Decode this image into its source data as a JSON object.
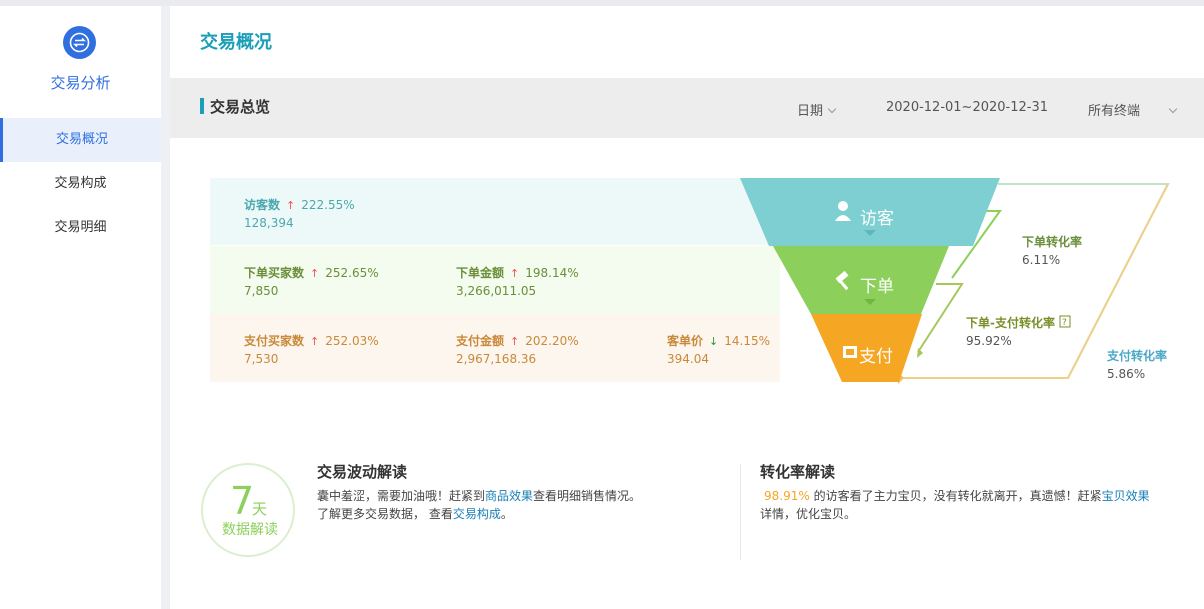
{
  "sidebar": {
    "title": "交易分析",
    "items": [
      {
        "label": "交易概况",
        "active": true
      },
      {
        "label": "交易构成",
        "active": false
      },
      {
        "label": "交易明细",
        "active": false
      }
    ]
  },
  "page": {
    "title": "交易概况",
    "section_title": "交易总览",
    "filters": {
      "date_label": "日期",
      "date_range": "2020-12-01~2020-12-31",
      "terminal": "所有终端"
    }
  },
  "rows": [
    {
      "metrics": [
        {
          "label": "访客数",
          "trend": "up",
          "pct": "222.55%",
          "value": "128,394"
        }
      ]
    },
    {
      "metrics": [
        {
          "label": "下单买家数",
          "trend": "up",
          "pct": "252.65%",
          "value": "7,850"
        },
        {
          "label": "下单金额",
          "trend": "up",
          "pct": "198.14%",
          "value": "3,266,011.05"
        }
      ]
    },
    {
      "metrics": [
        {
          "label": "支付买家数",
          "trend": "up",
          "pct": "252.03%",
          "value": "7,530"
        },
        {
          "label": "支付金额",
          "trend": "up",
          "pct": "202.20%",
          "value": "2,967,168.36"
        },
        {
          "label": "客单价",
          "trend": "down",
          "pct": "14.15%",
          "value": "394.04"
        }
      ]
    }
  ],
  "funnel": {
    "stages": [
      "访客",
      "下单",
      "支付"
    ],
    "rates": [
      {
        "label": "下单转化率",
        "value": "6.11%"
      },
      {
        "label": "下单-支付转化率",
        "value": "95.92%"
      },
      {
        "label": "支付转化率",
        "value": "5.86%"
      }
    ]
  },
  "insights": {
    "badge_number": "7",
    "badge_unit": "天",
    "badge_caption": "数据解读",
    "wave": {
      "title": "交易波动解读",
      "line1_pre": "囊中羞涩，需要加油哦！赶紧到",
      "line1_link": "商品效果",
      "line1_post": "查看明细销售情况。",
      "line2_pre": "了解更多交易数据，  查看",
      "line2_link": "交易构成",
      "line2_post": "。"
    },
    "conversion": {
      "title": "转化率解读",
      "highlight": "98.91%",
      "line1_post": " 的访客看了主力宝贝，没有转化就离开，真遗憾！赶紧",
      "line1_link": "宝贝效果",
      "line2": "详情，优化宝贝。"
    }
  },
  "colors": {
    "accent": "#1a9fb8",
    "brand_blue": "#2f6fe0",
    "visitor": "#7ecfd2",
    "order": "#8ccf5a",
    "pay": "#f5a623"
  },
  "icons": [
    "swap-icon",
    "user-icon",
    "gavel-icon",
    "card-icon",
    "up-arrow-icon",
    "down-arrow-icon",
    "help-icon",
    "chevron-down-icon"
  ]
}
